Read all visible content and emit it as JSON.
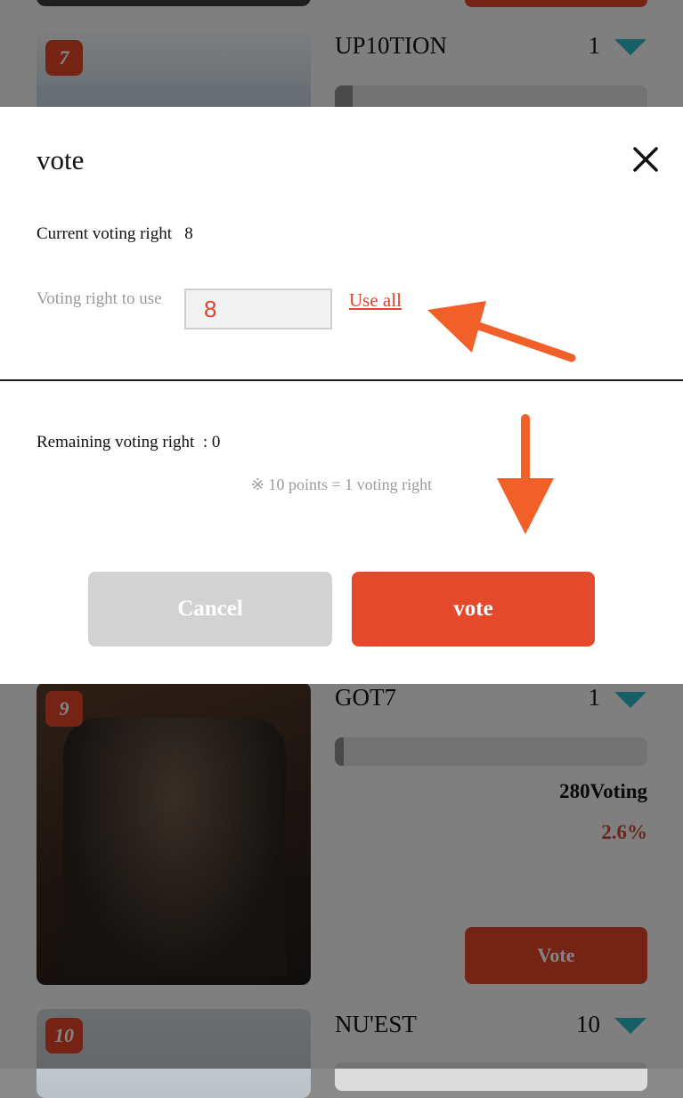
{
  "list": {
    "items": [
      {
        "rank": "7",
        "name": "UP10TION",
        "count": "1"
      },
      {
        "rank": "9",
        "name": "GOT7",
        "count": "1",
        "votes": "280Voting",
        "percent": "2.6%",
        "bar_fraction": 0.026,
        "vote_label": "Vote"
      },
      {
        "rank": "10",
        "name": "NU'EST",
        "count": "10"
      }
    ]
  },
  "modal": {
    "title": "vote",
    "current_label": "Current voting right",
    "current_value": "8",
    "use_label": "Voting right to use",
    "use_value": "8",
    "use_all": "Use all",
    "remaining_label": "Remaining voting right",
    "remaining_value": ": 0",
    "note": "※ 10 points = 1 voting right",
    "cancel_label": "Cancel",
    "vote_label": "vote"
  },
  "colors": {
    "accent": "#e0442a",
    "teal": "#2db6c4",
    "annotation_arrow": "#f2602a"
  },
  "icons": [
    "close-icon",
    "triangle-down-icon",
    "arrow-annotation"
  ]
}
